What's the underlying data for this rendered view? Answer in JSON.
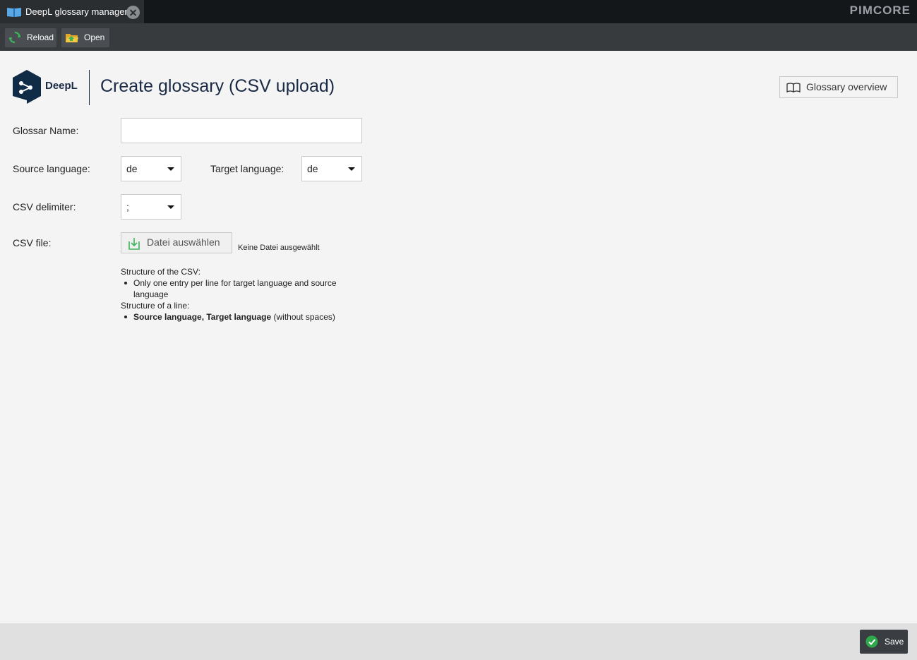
{
  "tab": {
    "title": "DeepL glossary manager",
    "icon": "book-icon"
  },
  "brand": "PIMCORE",
  "toolbar": {
    "reload": "Reload",
    "open": "Open"
  },
  "header": {
    "logo_text": "DeepL",
    "title": "Create glossary (CSV upload)",
    "overview_button": "Glossary overview"
  },
  "form": {
    "glossary_name_label": "Glossar Name:",
    "glossary_name_value": "",
    "source_language_label": "Source language:",
    "source_language_value": "de",
    "target_language_label": "Target language:",
    "target_language_value": "de",
    "csv_delimiter_label": "CSV delimiter:",
    "csv_delimiter_value": ";",
    "csv_file_label": "CSV file:",
    "file_button": "Datei auswählen",
    "file_status": "Keine Datei ausgewählt"
  },
  "info": {
    "structure_csv_heading": "Structure of the CSV:",
    "structure_csv_item": "Only one entry per line for target language and source language",
    "structure_line_heading": "Structure of a line:",
    "structure_line_item_bold": "Source language, Target language",
    "structure_line_item_rest": " (without spaces)"
  },
  "footer": {
    "save": "Save"
  },
  "colors": {
    "accent_green": "#2ea84a",
    "title_navy": "#1a2a45",
    "toolbar_bg": "#383b3e"
  }
}
